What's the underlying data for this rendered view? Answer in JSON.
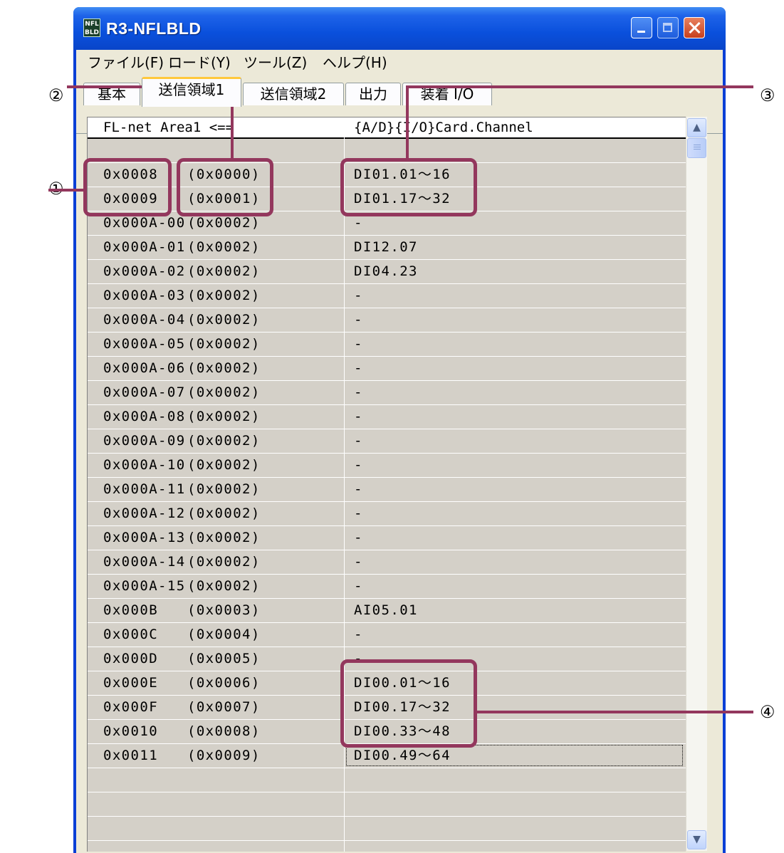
{
  "window": {
    "title": "R3-NFLBLD",
    "icon_text": "NFL BLD"
  },
  "menu": [
    "ファイル(F)",
    "ロード(Y)",
    "ツール(Z)",
    "ヘルプ(H)"
  ],
  "tabs": [
    {
      "label": "基本",
      "active": false
    },
    {
      "label": "送信領域1",
      "active": true
    },
    {
      "label": "送信領域2",
      "active": false
    },
    {
      "label": "出力",
      "active": false
    },
    {
      "label": "装着 I/O",
      "active": false
    }
  ],
  "grid": {
    "header_left": "FL-net Area1   <==",
    "header_right": "{A/D}{I/O}Card.Channel",
    "rows": [
      {
        "addr": "",
        "off": "",
        "chan": ""
      },
      {
        "addr": "0x0008",
        "off": "(0x0000)",
        "chan": "DI01.01～16"
      },
      {
        "addr": "0x0009",
        "off": "(0x0001)",
        "chan": "DI01.17～32"
      },
      {
        "addr": "0x000A-00",
        "off": "(0x0002)",
        "chan": "-"
      },
      {
        "addr": "0x000A-01",
        "off": "(0x0002)",
        "chan": "DI12.07"
      },
      {
        "addr": "0x000A-02",
        "off": "(0x0002)",
        "chan": "DI04.23"
      },
      {
        "addr": "0x000A-03",
        "off": "(0x0002)",
        "chan": "-"
      },
      {
        "addr": "0x000A-04",
        "off": "(0x0002)",
        "chan": "-"
      },
      {
        "addr": "0x000A-05",
        "off": "(0x0002)",
        "chan": "-"
      },
      {
        "addr": "0x000A-06",
        "off": "(0x0002)",
        "chan": "-"
      },
      {
        "addr": "0x000A-07",
        "off": "(0x0002)",
        "chan": "-"
      },
      {
        "addr": "0x000A-08",
        "off": "(0x0002)",
        "chan": "-"
      },
      {
        "addr": "0x000A-09",
        "off": "(0x0002)",
        "chan": "-"
      },
      {
        "addr": "0x000A-10",
        "off": "(0x0002)",
        "chan": "-"
      },
      {
        "addr": "0x000A-11",
        "off": "(0x0002)",
        "chan": "-"
      },
      {
        "addr": "0x000A-12",
        "off": "(0x0002)",
        "chan": "-"
      },
      {
        "addr": "0x000A-13",
        "off": "(0x0002)",
        "chan": "-"
      },
      {
        "addr": "0x000A-14",
        "off": "(0x0002)",
        "chan": "-"
      },
      {
        "addr": "0x000A-15",
        "off": "(0x0002)",
        "chan": "-"
      },
      {
        "addr": "0x000B",
        "off": "(0x0003)",
        "chan": "AI05.01"
      },
      {
        "addr": "0x000C",
        "off": "(0x0004)",
        "chan": "-"
      },
      {
        "addr": "0x000D",
        "off": "(0x0005)",
        "chan": "-"
      },
      {
        "addr": "0x000E",
        "off": "(0x0006)",
        "chan": "DI00.01～16"
      },
      {
        "addr": "0x000F",
        "off": "(0x0007)",
        "chan": "DI00.17～32"
      },
      {
        "addr": "0x0010",
        "off": "(0x0008)",
        "chan": "DI00.33～48"
      },
      {
        "addr": "0x0011",
        "off": "(0x0009)",
        "chan": "DI00.49～64"
      },
      {
        "addr": "",
        "off": "",
        "chan": ""
      },
      {
        "addr": "",
        "off": "",
        "chan": ""
      },
      {
        "addr": "",
        "off": "",
        "chan": ""
      }
    ]
  },
  "annotations": [
    "①",
    "②",
    "③",
    "④"
  ],
  "colors": {
    "annotation": "#93375d",
    "title_bar": "#0a50dc",
    "grid_bg": "#d4d0c8",
    "active_tab_accent": "#ffc83c"
  },
  "icons": [
    "app-icon",
    "minimize-icon",
    "maximize-icon",
    "close-icon",
    "scroll-up-icon",
    "scroll-down-icon"
  ]
}
